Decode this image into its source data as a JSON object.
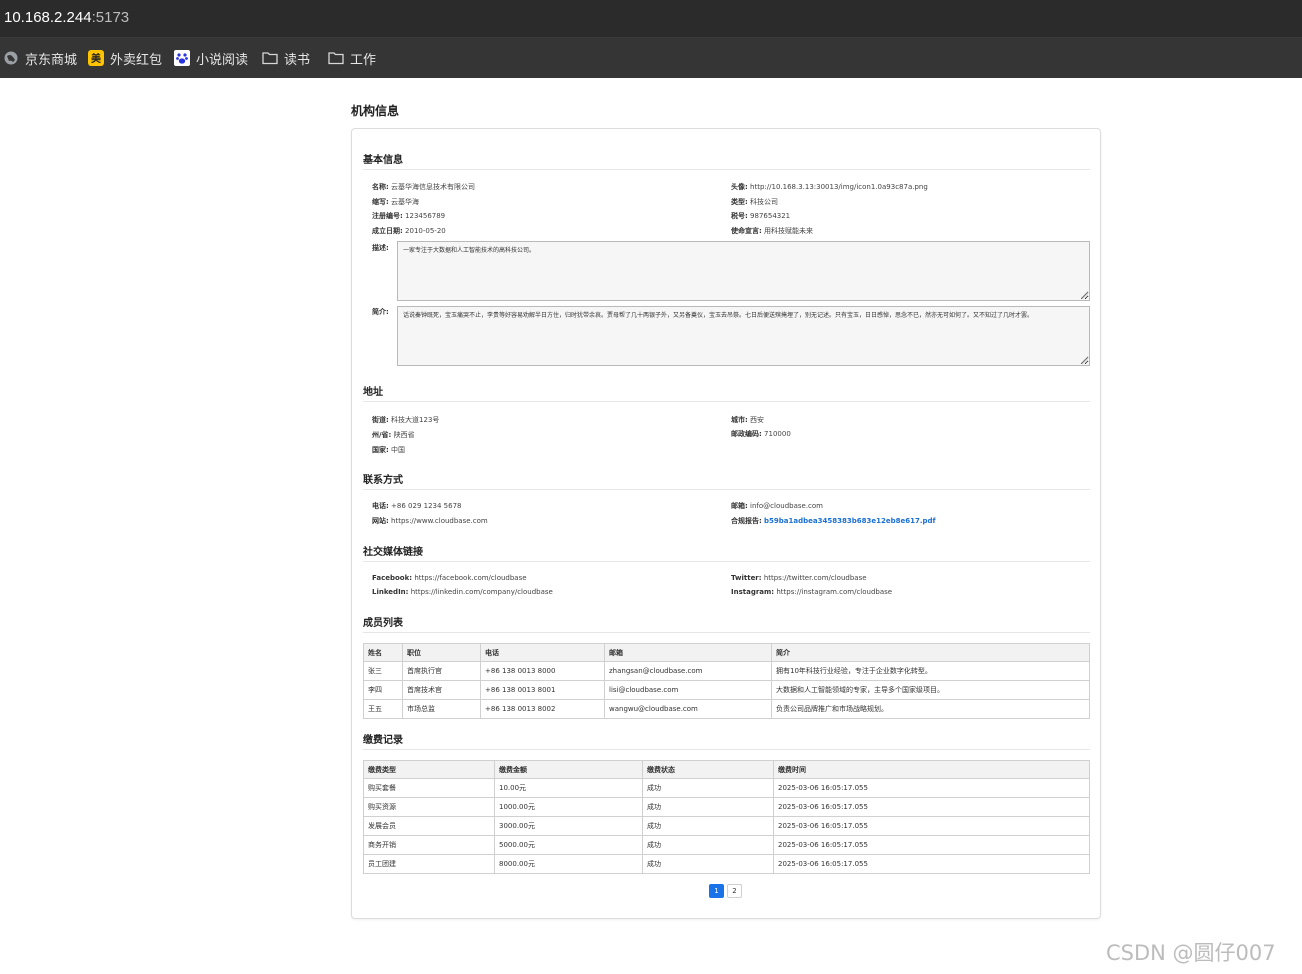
{
  "browser": {
    "url_host": "10.168.2.244",
    "url_port": ":5173",
    "bookmarks": [
      {
        "label": "京东商城",
        "icon": "globe-icon"
      },
      {
        "label": "外卖红包",
        "icon": "meituan-icon"
      },
      {
        "label": "小说阅读",
        "icon": "baidu-paw-icon"
      },
      {
        "label": "读书",
        "icon": "folder-icon"
      },
      {
        "label": "工作",
        "icon": "folder-icon"
      }
    ]
  },
  "page": {
    "title": "机构信息"
  },
  "basic": {
    "title": "基本信息",
    "left": [
      {
        "key": "名称:",
        "value": "云基华海信息技术有限公司"
      },
      {
        "key": "缩写:",
        "value": "云基华海"
      },
      {
        "key": "注册编号:",
        "value": "123456789"
      },
      {
        "key": "成立日期:",
        "value": "2010-05-20"
      }
    ],
    "right": [
      {
        "key": "头像:",
        "value": "http://10.168.3.13:30013/img/icon1.0a93c87a.png"
      },
      {
        "key": "类型:",
        "value": "科技公司"
      },
      {
        "key": "税号:",
        "value": "987654321"
      },
      {
        "key": "使命宣言:",
        "value": "用科技赋能未来"
      }
    ],
    "desc_label": "描述:",
    "desc_value": "一家专注于大数据和人工智能技术的高科技公司。",
    "intro_label": "简介:",
    "intro_value": "话说秦钟既死，宝玉痛哭不止，李贵等好容易劝解半日方住，归时犹带余哀。贾母帮了几十两银子外，又另备奠仪，宝玉去吊祭。七日后便送殡掩埋了，别无记述。只有宝玉，日日感悼，思念不已，然亦无可如何了。又不知过了几时才罢。"
  },
  "address": {
    "title": "地址",
    "left": [
      {
        "key": "街道:",
        "value": "科技大道123号"
      },
      {
        "key": "州/省:",
        "value": "陕西省"
      },
      {
        "key": "国家:",
        "value": "中国"
      }
    ],
    "right": [
      {
        "key": "城市:",
        "value": "西安"
      },
      {
        "key": "邮政编码:",
        "value": "710000"
      }
    ]
  },
  "contact": {
    "title": "联系方式",
    "phone_key": "电话:",
    "phone": "+86 029 1234 5678",
    "site_key": "网站:",
    "site": "https://www.cloudbase.com",
    "email_key": "邮箱:",
    "email": "info@cloudbase.com",
    "report_key": "合规报告:",
    "report": "b59ba1adbea3458383b683e12eb8e617.pdf"
  },
  "social": {
    "title": "社交媒体链接",
    "facebook_key": "Facebook:",
    "facebook": "https://facebook.com/cloudbase",
    "linkedin_key": "LinkedIn:",
    "linkedin": "https://linkedin.com/company/cloudbase",
    "twitter_key": "Twitter:",
    "twitter": "https://twitter.com/cloudbase",
    "instagram_key": "Instagram:",
    "instagram": "https://instagram.com/cloudbase"
  },
  "members": {
    "title": "成员列表",
    "headers": [
      "姓名",
      "职位",
      "电话",
      "邮箱",
      "简介"
    ],
    "rows": [
      [
        "张三",
        "首席执行官",
        "+86 138 0013 8000",
        "zhangsan@cloudbase.com",
        "拥有10年科技行业经验，专注于企业数字化转型。"
      ],
      [
        "李四",
        "首席技术官",
        "+86 138 0013 8001",
        "lisi@cloudbase.com",
        "大数据和人工智能领域的专家，主导多个国家级项目。"
      ],
      [
        "王五",
        "市场总监",
        "+86 138 0013 8002",
        "wangwu@cloudbase.com",
        "负责公司品牌推广和市场战略规划。"
      ]
    ]
  },
  "payments": {
    "title": "缴费记录",
    "headers": [
      "缴费类型",
      "缴费金额",
      "缴费状态",
      "缴费时间"
    ],
    "rows": [
      [
        "购买套餐",
        "10.00元",
        "成功",
        "2025-03-06 16:05:17.055"
      ],
      [
        "购买资源",
        "1000.00元",
        "成功",
        "2025-03-06 16:05:17.055"
      ],
      [
        "发展会员",
        "3000.00元",
        "成功",
        "2025-03-06 16:05:17.055"
      ],
      [
        "商务开销",
        "5000.00元",
        "成功",
        "2025-03-06 16:05:17.055"
      ],
      [
        "员工团建",
        "8000.00元",
        "成功",
        "2025-03-06 16:05:17.055"
      ]
    ]
  },
  "pagination": {
    "pages": [
      "1",
      "2"
    ],
    "current": "1"
  },
  "watermark": "CSDN @圆仔007"
}
